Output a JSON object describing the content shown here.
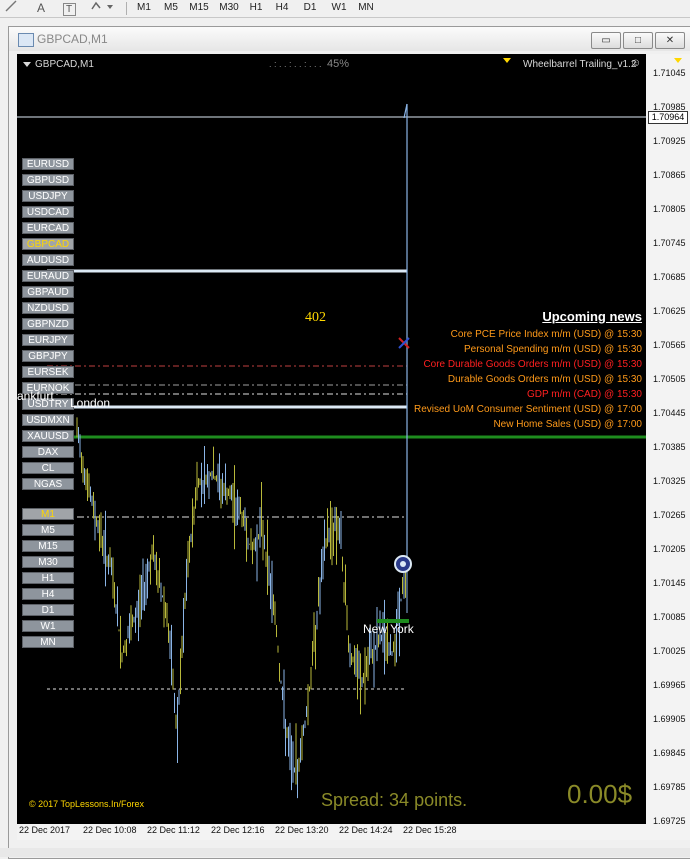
{
  "toolbar": {
    "icons": [
      "line-tool-icon",
      "text-tool-icon",
      "label-tool-icon",
      "shapes-tool-icon"
    ],
    "text_tool_glyph": "A",
    "label_glyph": "T",
    "timeframes": [
      "M1",
      "M5",
      "M15",
      "M30",
      "H1",
      "H4",
      "D1",
      "W1",
      "MN"
    ]
  },
  "window": {
    "title": "GBPCAD,M1",
    "minimize_glyph": "▭",
    "maximize_glyph": "□",
    "close_glyph": "✕"
  },
  "chart": {
    "symbol_label": "GBPCAD,M1",
    "progress_dots": ". : . . : . . : . . .",
    "progress_text": "45%",
    "indicator_name": "Wheelbarrel Trailing_v1.2",
    "symbols": [
      "EURUSD",
      "GBPUSD",
      "USDJPY",
      "USDCAD",
      "EURCAD",
      "GBPCAD",
      "AUDUSD",
      "EURAUD",
      "GBPAUD",
      "NZDUSD",
      "GBPNZD",
      "EURJPY",
      "GBPJPY",
      "EURSEK",
      "EURNOK",
      "USDTRY",
      "USDMXN",
      "XAUUSD",
      "DAX",
      "CL",
      "NGAS"
    ],
    "active_symbol": "GBPCAD",
    "timeframes": [
      "M1",
      "M5",
      "M15",
      "M30",
      "H1",
      "H4",
      "D1",
      "W1",
      "MN"
    ],
    "active_timeframe": "M1",
    "number_402": "402",
    "frankfurt_label": "ankfurt",
    "london_label": "London",
    "newyork_label": "New York",
    "news_title": "Upcoming news",
    "news": [
      {
        "text": "Core PCE Price Index m/m (USD) @ 15:30",
        "color": "#ff9a1a"
      },
      {
        "text": "Personal Spending m/m (USD) @ 15:30",
        "color": "#ff9a1a"
      },
      {
        "text": "Core Durable Goods Orders m/m (USD) @ 15:30",
        "color": "#ff2020"
      },
      {
        "text": "Durable Goods Orders m/m (USD) @ 15:30",
        "color": "#ff9a1a"
      },
      {
        "text": "GDP m/m (CAD) @ 15:30",
        "color": "#ff2020"
      },
      {
        "text": "Revised UoM Consumer Sentiment (USD) @ 17:00",
        "color": "#ff9a1a"
      },
      {
        "text": "New Home Sales (USD) @ 17:00",
        "color": "#ff9a1a"
      }
    ],
    "copyright": "© 2017 TopLessons.In/Forex",
    "spread_text": "Spread: 34 points.",
    "profit_text": "0.00$",
    "current_price": "1.70964",
    "price_axis": [
      "1.71045",
      "1.70985",
      "1.70925",
      "1.70865",
      "1.70805",
      "1.70745",
      "1.70685",
      "1.70625",
      "1.70565",
      "1.70505",
      "1.70445",
      "1.70385",
      "1.70325",
      "1.70265",
      "1.70205",
      "1.70145",
      "1.70085",
      "1.70025",
      "1.69965",
      "1.69905",
      "1.69845",
      "1.69785",
      "1.69725"
    ],
    "time_axis": [
      "22 Dec 2017",
      "22 Dec 10:08",
      "22 Dec 11:12",
      "22 Dec 12:16",
      "22 Dec 13:20",
      "22 Dec 14:24",
      "22 Dec 15:28"
    ],
    "colors": {
      "background": "#000000",
      "bull_candle": "#8ab4e6",
      "bear_candle": "#b8b83a",
      "level_line": "#dce9f5",
      "green_line": "#1e8c1e",
      "news_orange": "#ff9a1a",
      "news_red": "#ff2020",
      "spread": "#8a8a28",
      "profit": "#8a8a28"
    }
  }
}
